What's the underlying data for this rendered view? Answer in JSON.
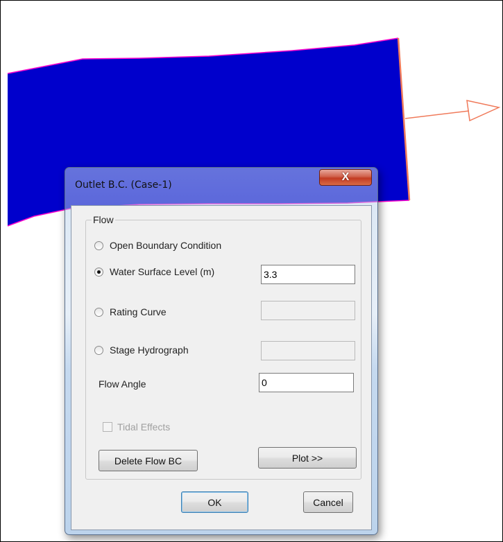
{
  "dialog": {
    "title": "Outlet B.C. (Case-1)",
    "close_label": "X",
    "flow_group_label": "Flow",
    "options": [
      {
        "label": "Open Boundary Condition",
        "selected": false
      },
      {
        "label": "Water Surface Level (m)",
        "selected": true,
        "value": "3.3"
      },
      {
        "label": "Rating Curve",
        "selected": false,
        "value": ""
      },
      {
        "label": "Stage Hydrograph",
        "selected": false,
        "value": ""
      }
    ],
    "flow_angle_label": "Flow Angle",
    "flow_angle_value": "0",
    "tidal_effects_label": "Tidal Effects",
    "tidal_effects_checked": false,
    "delete_flow_bc_label": "Delete Flow BC",
    "plot_label": "Plot >>",
    "ok_label": "OK",
    "cancel_label": "Cancel"
  },
  "canvas": {
    "mesh_color": "#0000cc",
    "boundary_color": "#ff00cc",
    "outlet_arrow_color": "#f07a5a"
  }
}
